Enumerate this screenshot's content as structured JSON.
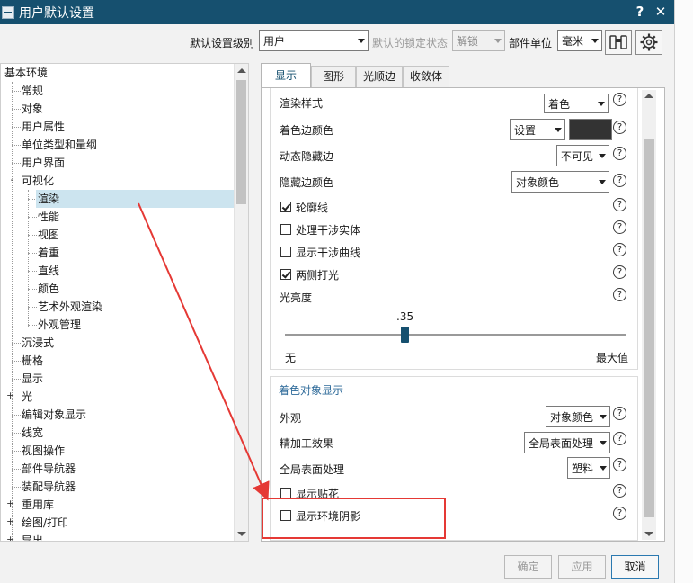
{
  "window": {
    "title": "用户默认设置",
    "help_label": "?",
    "close_label": "✕"
  },
  "toolbar": {
    "level_label": "默认设置级别",
    "level_value": "用户",
    "lock_label": "默认的锁定状态",
    "lock_value": "解锁",
    "unit_label": "部件单位",
    "unit_value": "毫米"
  },
  "tree": {
    "root": "基本环境",
    "items": [
      "常规",
      "对象",
      "用户属性",
      "单位类型和量纲",
      "用户界面",
      "可视化"
    ],
    "vis_children": [
      "渲染",
      "性能",
      "视图",
      "着重",
      "直线",
      "颜色",
      "艺术外观渲染",
      "外观管理"
    ],
    "after": [
      "沉浸式",
      "栅格",
      "显示",
      "光",
      "编辑对象显示",
      "线宽",
      "视图操作",
      "部件导航器",
      "装配导航器",
      "重用库",
      "绘图/打印",
      "导出"
    ]
  },
  "tabs": [
    "显示",
    "图形",
    "光顺边",
    "收敛体"
  ],
  "panel": {
    "render_style_label": "渲染样式",
    "render_style_value": "着色",
    "shaded_edge_color_label": "着色边颜色",
    "shaded_edge_color_value": "设置",
    "shaded_edge_swatch": "#333333",
    "dynamic_hidden_label": "动态隐藏边",
    "dynamic_hidden_value": "不可见",
    "hidden_edge_color_label": "隐藏边颜色",
    "hidden_edge_color_value": "对象颜色",
    "cb_silhouette": "轮廓线",
    "cb_interference_solid": "处理干涉实体",
    "cb_interference_curve": "显示干涉曲线",
    "cb_two_sided": "两侧打光",
    "brightness_label": "光亮度",
    "brightness_value": ".35",
    "brightness_fraction": 0.35,
    "brightness_min": "无",
    "brightness_max": "最大值",
    "shaded_section_title": "着色对象显示",
    "appearance_label": "外观",
    "appearance_value": "对象颜色",
    "finish_label": "精加工效果",
    "finish_value": "全局表面处理",
    "global_surface_label": "全局表面处理",
    "global_surface_value": "塑料",
    "cb_decals": "显示贴花",
    "cb_env_shadow": "显示环境阴影"
  },
  "buttons": {
    "ok": "确定",
    "apply": "应用",
    "cancel": "取消"
  },
  "colors": {
    "titlebar": "#16506f",
    "selection": "#cce4ef",
    "annotation": "#e53935"
  }
}
